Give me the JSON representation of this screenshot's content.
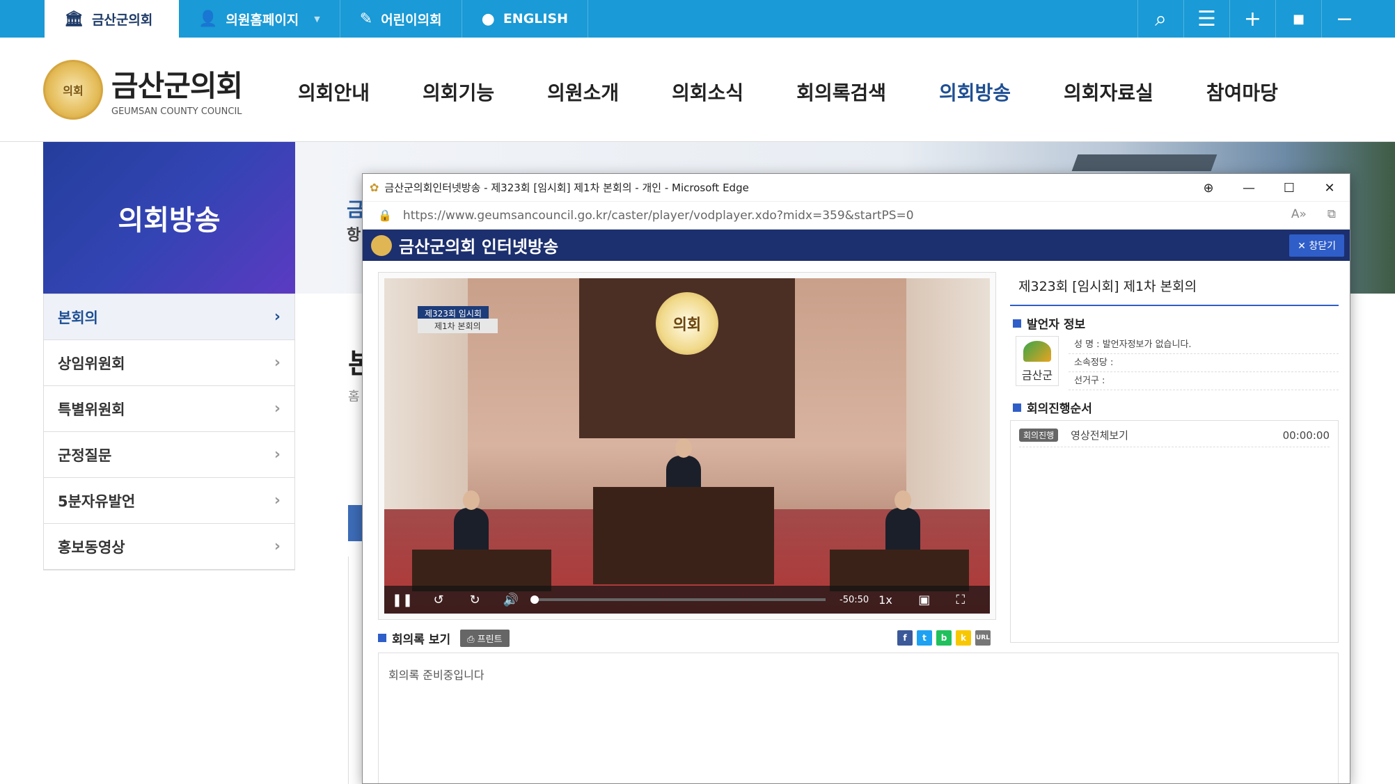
{
  "topbar": {
    "tabs": [
      {
        "label": "금산군의회",
        "icon": "building-icon"
      },
      {
        "label": "의원홈페이지",
        "icon": "person-icon"
      },
      {
        "label": "어린이의회",
        "icon": "brush-icon"
      },
      {
        "label": "ENGLISH",
        "icon": "globe-icon"
      }
    ],
    "tools": [
      "search-icon",
      "menu-icon",
      "plus-icon",
      "square-icon",
      "minus-icon"
    ],
    "accent": "#1a9ad6"
  },
  "header": {
    "logo_name": "금산군의회",
    "logo_sub": "GEUMSAN COUNTY COUNCIL",
    "seal_text": "의회",
    "nav": [
      "의회안내",
      "의회기능",
      "의원소개",
      "의회소식",
      "회의록검색",
      "의회방송",
      "의회자료실",
      "참여마당"
    ],
    "nav_active": "의회방송"
  },
  "sidebar": {
    "title": "의회방송",
    "items": [
      {
        "label": "본회의",
        "active": true
      },
      {
        "label": "상임위원회"
      },
      {
        "label": "특별위원회"
      },
      {
        "label": "군정질문"
      },
      {
        "label": "5분자유발언"
      },
      {
        "label": "홍보동영상"
      }
    ]
  },
  "behind": {
    "heading_char": "금",
    "sub_char": "항",
    "title_char": "본",
    "crumb_char": "홈"
  },
  "popup": {
    "window_title": "금산군의회인터넷방송 - 제323회 [임시회] 제1차 본회의 - 개인 - Microsoft Edge",
    "url": "https://www.geumsancouncil.go.kr/caster/player/vodplayer.xdo?midx=359&startPS=0",
    "player_title": "금산군의회 인터넷방송",
    "close_label": "창닫기",
    "meeting_title": "제323회 [임시회] 제1차 본회의",
    "video": {
      "caption_line1": "제323회 임시회",
      "caption_line2": "제1차 본회의",
      "seal_text": "의회",
      "remaining": "-50:50",
      "speed": "1x",
      "progress": 0.0
    },
    "speaker_section": "발언자 정보",
    "speaker_logo_label": "금산군",
    "speaker_fields": [
      "성 명 : 발언자정보가 없습니다.",
      "소속정당 :",
      "선거구 :"
    ],
    "agenda_section": "회의진행순서",
    "agenda": [
      {
        "badge": "회의진행",
        "label": "영상전체보기",
        "time": "00:00:00"
      }
    ],
    "minutes_section": "회의록 보기",
    "print_label": "프린트",
    "share_buttons": [
      {
        "name": "facebook-share-icon",
        "glyph": "f",
        "color": "#3b5998"
      },
      {
        "name": "twitter-share-icon",
        "glyph": "t",
        "color": "#1da1f2"
      },
      {
        "name": "band-share-icon",
        "glyph": "b",
        "color": "#20c05c"
      },
      {
        "name": "kakao-share-icon",
        "glyph": "k",
        "color": "#f9c700"
      },
      {
        "name": "url-share-icon",
        "glyph": "URL",
        "color": "#777777"
      }
    ],
    "minutes_text": "회의록 준비중입니다"
  }
}
